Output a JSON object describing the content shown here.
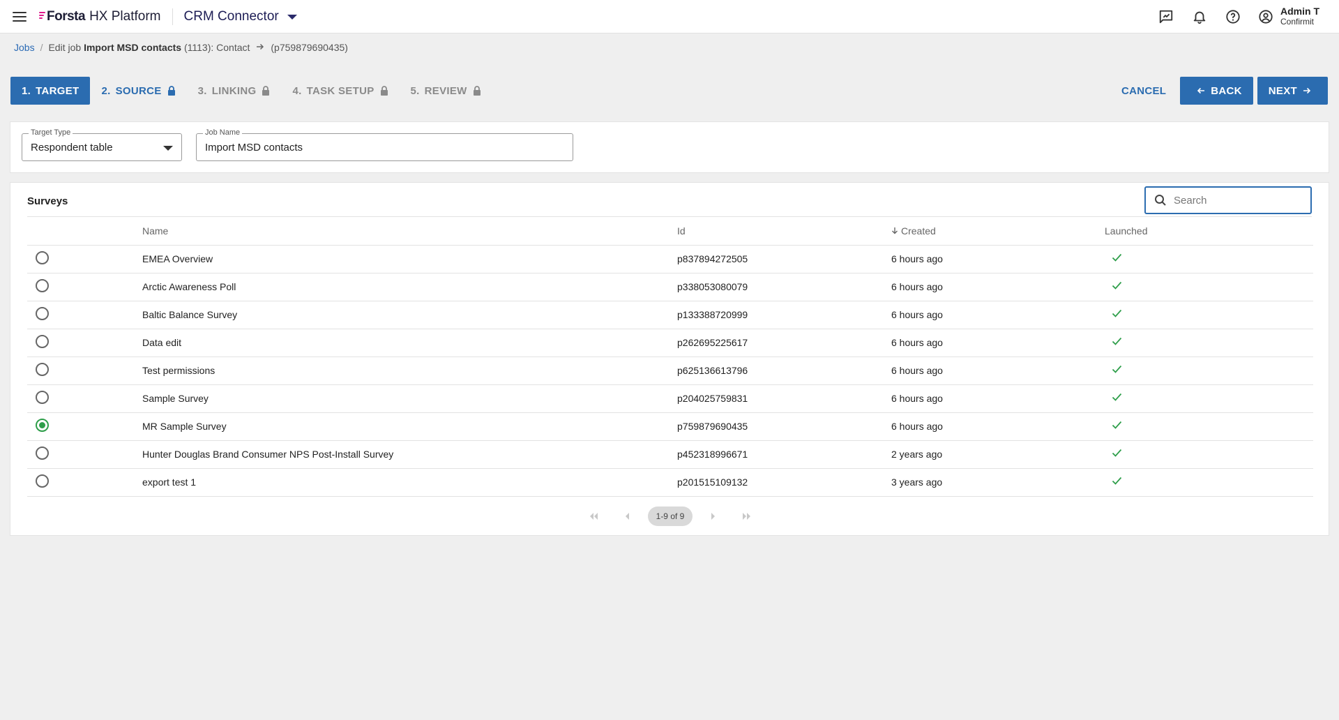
{
  "topbar": {
    "brand": "Forsta",
    "platform": "HX Platform",
    "app": "CRM Connector",
    "user_name": "Admin T",
    "user_org": "Confirmit"
  },
  "breadcrumb": {
    "jobs": "Jobs",
    "separator": "/",
    "prefix": "Edit job",
    "job_name": "Import MSD contacts",
    "job_meta": "(1113): Contact",
    "target_id": "(p759879690435)"
  },
  "steps": [
    {
      "num": "1.",
      "label": "TARGET",
      "state": "active",
      "locked": false
    },
    {
      "num": "2.",
      "label": "SOURCE",
      "state": "enabled",
      "locked": true
    },
    {
      "num": "3.",
      "label": "LINKING",
      "state": "disabled",
      "locked": true
    },
    {
      "num": "4.",
      "label": "TASK SETUP",
      "state": "disabled",
      "locked": true
    },
    {
      "num": "5.",
      "label": "REVIEW",
      "state": "disabled",
      "locked": true
    }
  ],
  "actions": {
    "cancel": "CANCEL",
    "back": "BACK",
    "next": "NEXT"
  },
  "form": {
    "target_type_label": "Target Type",
    "target_type_value": "Respondent table",
    "job_name_label": "Job Name",
    "job_name_value": "Import MSD contacts"
  },
  "surveys": {
    "title": "Surveys",
    "search_placeholder": "Search",
    "columns": {
      "name": "Name",
      "id": "Id",
      "created": "Created",
      "launched": "Launched"
    },
    "rows": [
      {
        "name": "EMEA Overview",
        "id": "p837894272505",
        "created": "6 hours ago",
        "launched": true,
        "selected": false
      },
      {
        "name": "Arctic Awareness Poll",
        "id": "p338053080079",
        "created": "6 hours ago",
        "launched": true,
        "selected": false
      },
      {
        "name": "Baltic Balance Survey",
        "id": "p133388720999",
        "created": "6 hours ago",
        "launched": true,
        "selected": false
      },
      {
        "name": "Data edit",
        "id": "p262695225617",
        "created": "6 hours ago",
        "launched": true,
        "selected": false
      },
      {
        "name": "Test permissions",
        "id": "p625136613796",
        "created": "6 hours ago",
        "launched": true,
        "selected": false
      },
      {
        "name": "Sample Survey",
        "id": "p204025759831",
        "created": "6 hours ago",
        "launched": true,
        "selected": false
      },
      {
        "name": "MR Sample Survey",
        "id": "p759879690435",
        "created": "6 hours ago",
        "launched": true,
        "selected": true
      },
      {
        "name": "Hunter Douglas Brand Consumer NPS Post-Install Survey",
        "id": "p452318996671",
        "created": "2 years ago",
        "launched": true,
        "selected": false
      },
      {
        "name": "export test 1",
        "id": "p201515109132",
        "created": "3 years ago",
        "launched": true,
        "selected": false
      }
    ],
    "pagination": "1-9 of 9"
  },
  "colors": {
    "primary": "#2b6cb0",
    "success": "#2e9e4a",
    "brand_accent": "#e0198c"
  }
}
